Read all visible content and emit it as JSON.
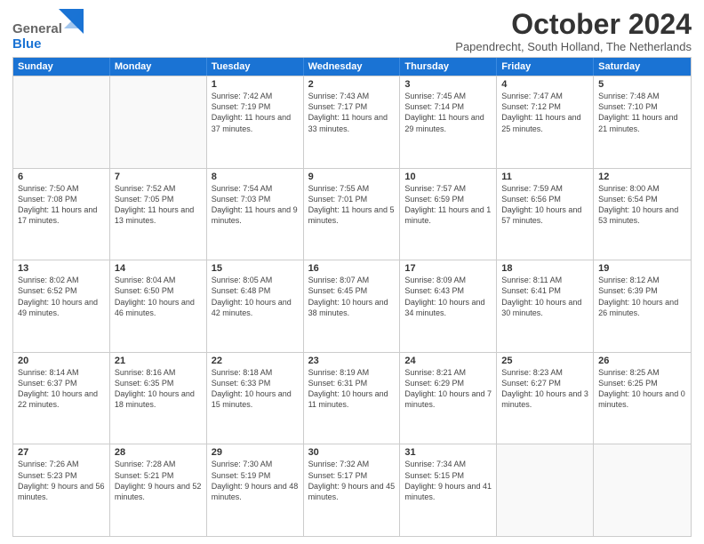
{
  "header": {
    "logo_general": "General",
    "logo_blue": "Blue",
    "month_title": "October 2024",
    "location": "Papendrecht, South Holland, The Netherlands"
  },
  "days_of_week": [
    "Sunday",
    "Monday",
    "Tuesday",
    "Wednesday",
    "Thursday",
    "Friday",
    "Saturday"
  ],
  "weeks": [
    [
      {
        "day": "",
        "text": ""
      },
      {
        "day": "",
        "text": ""
      },
      {
        "day": "1",
        "text": "Sunrise: 7:42 AM\nSunset: 7:19 PM\nDaylight: 11 hours and 37 minutes."
      },
      {
        "day": "2",
        "text": "Sunrise: 7:43 AM\nSunset: 7:17 PM\nDaylight: 11 hours and 33 minutes."
      },
      {
        "day": "3",
        "text": "Sunrise: 7:45 AM\nSunset: 7:14 PM\nDaylight: 11 hours and 29 minutes."
      },
      {
        "day": "4",
        "text": "Sunrise: 7:47 AM\nSunset: 7:12 PM\nDaylight: 11 hours and 25 minutes."
      },
      {
        "day": "5",
        "text": "Sunrise: 7:48 AM\nSunset: 7:10 PM\nDaylight: 11 hours and 21 minutes."
      }
    ],
    [
      {
        "day": "6",
        "text": "Sunrise: 7:50 AM\nSunset: 7:08 PM\nDaylight: 11 hours and 17 minutes."
      },
      {
        "day": "7",
        "text": "Sunrise: 7:52 AM\nSunset: 7:05 PM\nDaylight: 11 hours and 13 minutes."
      },
      {
        "day": "8",
        "text": "Sunrise: 7:54 AM\nSunset: 7:03 PM\nDaylight: 11 hours and 9 minutes."
      },
      {
        "day": "9",
        "text": "Sunrise: 7:55 AM\nSunset: 7:01 PM\nDaylight: 11 hours and 5 minutes."
      },
      {
        "day": "10",
        "text": "Sunrise: 7:57 AM\nSunset: 6:59 PM\nDaylight: 11 hours and 1 minute."
      },
      {
        "day": "11",
        "text": "Sunrise: 7:59 AM\nSunset: 6:56 PM\nDaylight: 10 hours and 57 minutes."
      },
      {
        "day": "12",
        "text": "Sunrise: 8:00 AM\nSunset: 6:54 PM\nDaylight: 10 hours and 53 minutes."
      }
    ],
    [
      {
        "day": "13",
        "text": "Sunrise: 8:02 AM\nSunset: 6:52 PM\nDaylight: 10 hours and 49 minutes."
      },
      {
        "day": "14",
        "text": "Sunrise: 8:04 AM\nSunset: 6:50 PM\nDaylight: 10 hours and 46 minutes."
      },
      {
        "day": "15",
        "text": "Sunrise: 8:05 AM\nSunset: 6:48 PM\nDaylight: 10 hours and 42 minutes."
      },
      {
        "day": "16",
        "text": "Sunrise: 8:07 AM\nSunset: 6:45 PM\nDaylight: 10 hours and 38 minutes."
      },
      {
        "day": "17",
        "text": "Sunrise: 8:09 AM\nSunset: 6:43 PM\nDaylight: 10 hours and 34 minutes."
      },
      {
        "day": "18",
        "text": "Sunrise: 8:11 AM\nSunset: 6:41 PM\nDaylight: 10 hours and 30 minutes."
      },
      {
        "day": "19",
        "text": "Sunrise: 8:12 AM\nSunset: 6:39 PM\nDaylight: 10 hours and 26 minutes."
      }
    ],
    [
      {
        "day": "20",
        "text": "Sunrise: 8:14 AM\nSunset: 6:37 PM\nDaylight: 10 hours and 22 minutes."
      },
      {
        "day": "21",
        "text": "Sunrise: 8:16 AM\nSunset: 6:35 PM\nDaylight: 10 hours and 18 minutes."
      },
      {
        "day": "22",
        "text": "Sunrise: 8:18 AM\nSunset: 6:33 PM\nDaylight: 10 hours and 15 minutes."
      },
      {
        "day": "23",
        "text": "Sunrise: 8:19 AM\nSunset: 6:31 PM\nDaylight: 10 hours and 11 minutes."
      },
      {
        "day": "24",
        "text": "Sunrise: 8:21 AM\nSunset: 6:29 PM\nDaylight: 10 hours and 7 minutes."
      },
      {
        "day": "25",
        "text": "Sunrise: 8:23 AM\nSunset: 6:27 PM\nDaylight: 10 hours and 3 minutes."
      },
      {
        "day": "26",
        "text": "Sunrise: 8:25 AM\nSunset: 6:25 PM\nDaylight: 10 hours and 0 minutes."
      }
    ],
    [
      {
        "day": "27",
        "text": "Sunrise: 7:26 AM\nSunset: 5:23 PM\nDaylight: 9 hours and 56 minutes."
      },
      {
        "day": "28",
        "text": "Sunrise: 7:28 AM\nSunset: 5:21 PM\nDaylight: 9 hours and 52 minutes."
      },
      {
        "day": "29",
        "text": "Sunrise: 7:30 AM\nSunset: 5:19 PM\nDaylight: 9 hours and 48 minutes."
      },
      {
        "day": "30",
        "text": "Sunrise: 7:32 AM\nSunset: 5:17 PM\nDaylight: 9 hours and 45 minutes."
      },
      {
        "day": "31",
        "text": "Sunrise: 7:34 AM\nSunset: 5:15 PM\nDaylight: 9 hours and 41 minutes."
      },
      {
        "day": "",
        "text": ""
      },
      {
        "day": "",
        "text": ""
      }
    ]
  ]
}
